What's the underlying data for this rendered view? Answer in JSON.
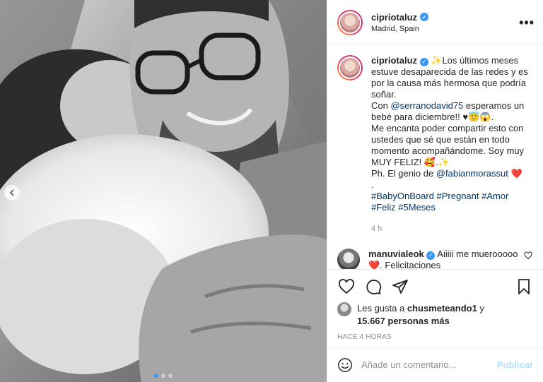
{
  "post": {
    "username": "cipriotaluz",
    "location": "Madrid, Spain",
    "more_label": "•••"
  },
  "caption": {
    "username": "cipriotaluz",
    "line1": "✨Los últimos meses estuve desaparecida de las redes y es por la causa más hermosa que podría soñar.",
    "line2a": "Con ",
    "mention1": "@serranodavid75",
    "line2b": " esperamos un bebé para diciembre!! ♥😇😱.",
    "line3": "Me encanta poder compartir esto con ustedes que sé que están en todo momento acompañándome. Soy muy MUY FELIZ! 🥰.✨",
    "line4a": "Ph. El genio de ",
    "mention2": "@fabianmorassut",
    "line4b": " ❤️",
    "line5": ".",
    "hashtags1": "#BabyOnBoard #Pregnant #Amor",
    "hashtags2": "#Feliz #5Meses",
    "time": "4 h"
  },
  "comment": {
    "username": "manuvialeok",
    "text": " Aiiiii me muerooooo ❤️. Felicitaciones"
  },
  "likes": {
    "prefix": "Les gusta a ",
    "user": "chusmeteando1",
    "mid": " y",
    "count": "15.667 personas más"
  },
  "posted_ago": "HACE 4 HORAS",
  "add_comment": {
    "placeholder": "Añade un comentario...",
    "publish_label": "Publicar"
  },
  "carousel": {
    "count": 3,
    "active": 0
  },
  "colors": {
    "accent": "#3897f0",
    "publish_disabled": "#b2dffc",
    "muted": "#8e8e8e"
  }
}
